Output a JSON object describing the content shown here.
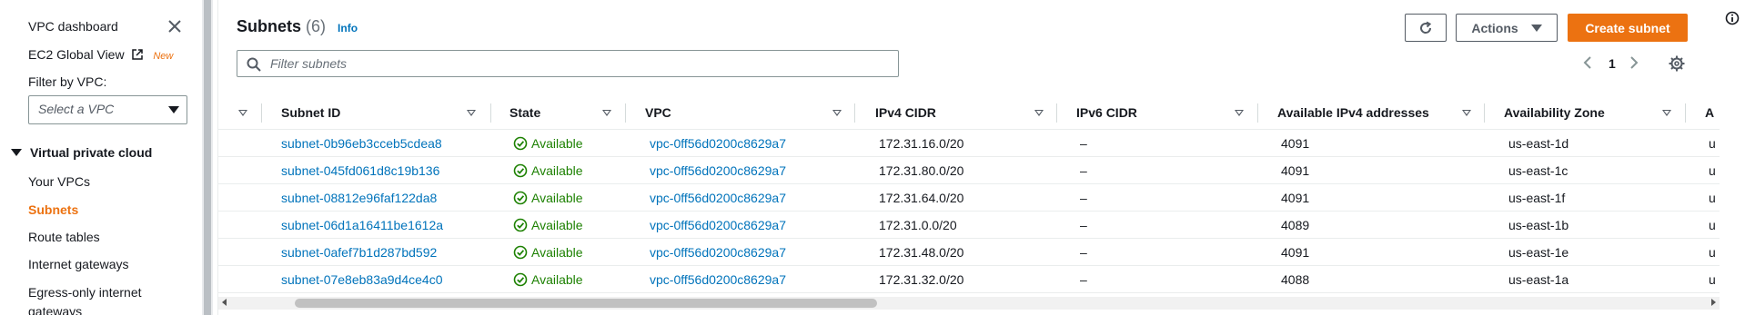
{
  "sidebar": {
    "dashboard": "VPC dashboard",
    "ec2_global_view": "EC2 Global View",
    "new_badge": "New",
    "filter_label": "Filter by VPC:",
    "filter_placeholder": "Select a VPC",
    "section_title": "Virtual private cloud",
    "items": [
      {
        "label": "Your VPCs"
      },
      {
        "label": "Subnets",
        "active": true
      },
      {
        "label": "Route tables"
      },
      {
        "label": "Internet gateways"
      },
      {
        "label": "Egress-only internet"
      },
      {
        "label": "gateways"
      }
    ]
  },
  "header": {
    "title": "Subnets",
    "count": "(6)",
    "info": "Info",
    "actions_label": "Actions",
    "create_label": "Create subnet",
    "filter_placeholder": "Filter subnets",
    "page": "1"
  },
  "table": {
    "columns": [
      "Subnet ID",
      "State",
      "VPC",
      "IPv4 CIDR",
      "IPv6 CIDR",
      "Available IPv4 addresses",
      "Availability Zone",
      "A"
    ],
    "rows": [
      {
        "subnet_id": "subnet-0b96eb3cceb5cdea8",
        "state": "Available",
        "vpc": "vpc-0ff56d0200c8629a7",
        "ipv4": "172.31.16.0/20",
        "ipv6": "–",
        "avail": "4091",
        "az": "us-east-1d",
        "extra": "u"
      },
      {
        "subnet_id": "subnet-045fd061d8c19b136",
        "state": "Available",
        "vpc": "vpc-0ff56d0200c8629a7",
        "ipv4": "172.31.80.0/20",
        "ipv6": "–",
        "avail": "4091",
        "az": "us-east-1c",
        "extra": "u"
      },
      {
        "subnet_id": "subnet-08812e96faf122da8",
        "state": "Available",
        "vpc": "vpc-0ff56d0200c8629a7",
        "ipv4": "172.31.64.0/20",
        "ipv6": "–",
        "avail": "4091",
        "az": "us-east-1f",
        "extra": "u"
      },
      {
        "subnet_id": "subnet-06d1a16411be1612a",
        "state": "Available",
        "vpc": "vpc-0ff56d0200c8629a7",
        "ipv4": "172.31.0.0/20",
        "ipv6": "–",
        "avail": "4089",
        "az": "us-east-1b",
        "extra": "u"
      },
      {
        "subnet_id": "subnet-0afef7b1d287bd592",
        "state": "Available",
        "vpc": "vpc-0ff56d0200c8629a7",
        "ipv4": "172.31.48.0/20",
        "ipv6": "–",
        "avail": "4091",
        "az": "us-east-1e",
        "extra": "u"
      },
      {
        "subnet_id": "subnet-07e8eb83a9d4ce4c0",
        "state": "Available",
        "vpc": "vpc-0ff56d0200c8629a7",
        "ipv4": "172.31.32.0/20",
        "ipv6": "–",
        "avail": "4088",
        "az": "us-east-1a",
        "extra": "u"
      }
    ]
  },
  "colors": {
    "accent": "#ec7211",
    "link": "#0073bb",
    "success": "#1d8102"
  },
  "icons": {
    "close": "close-icon",
    "external": "external-link-icon",
    "search": "search-icon",
    "refresh": "refresh-icon",
    "settings": "gear-icon",
    "info": "info-icon"
  }
}
